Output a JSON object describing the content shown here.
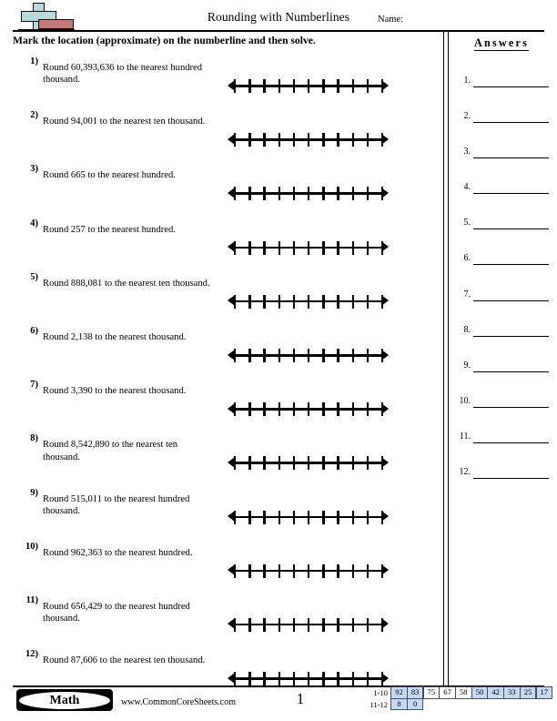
{
  "header": {
    "title": "Rounding with Numberlines",
    "name_label": "Name:",
    "logo_icon": "math-plus-bar-logo"
  },
  "instructions": "Mark the location (approximate) on the numberline and then solve.",
  "numberline": {
    "tick_count": 11,
    "left_arrow_icon": "arrow-left-icon",
    "right_arrow_icon": "arrow-right-icon"
  },
  "problems": [
    {
      "number": "1)",
      "text": "Round 60,393,636 to the nearest hundred thousand."
    },
    {
      "number": "2)",
      "text": "Round 94,001 to the nearest ten thousand."
    },
    {
      "number": "3)",
      "text": "Round 665 to the nearest hundred."
    },
    {
      "number": "4)",
      "text": "Round 257 to the nearest hundred."
    },
    {
      "number": "5)",
      "text": "Round 888,081 to the nearest ten thousand."
    },
    {
      "number": "6)",
      "text": "Round 2,138 to the nearest thousand."
    },
    {
      "number": "7)",
      "text": "Round 3,390 to the nearest thousand."
    },
    {
      "number": "8)",
      "text": "Round 8,542,890 to the nearest ten thousand."
    },
    {
      "number": "9)",
      "text": "Round 515,011 to the nearest hundred thousand."
    },
    {
      "number": "10)",
      "text": "Round 962,363 to the nearest hundred."
    },
    {
      "number": "11)",
      "text": "Round 656,429 to the nearest hundred thousand."
    },
    {
      "number": "12)",
      "text": "Round 87,606 to the nearest ten thousand."
    }
  ],
  "answers": {
    "title": "Answers",
    "items": [
      {
        "number": "1."
      },
      {
        "number": "2."
      },
      {
        "number": "3."
      },
      {
        "number": "4."
      },
      {
        "number": "5."
      },
      {
        "number": "6."
      },
      {
        "number": "7."
      },
      {
        "number": "8."
      },
      {
        "number": "9."
      },
      {
        "number": "10."
      },
      {
        "number": "11."
      },
      {
        "number": "12."
      }
    ]
  },
  "footer": {
    "subject_badge": "Math",
    "site_url": "www.CommonCoreSheets.com",
    "page_number": "1"
  },
  "score_grid": {
    "rows": [
      {
        "label": "1-10",
        "cells": [
          {
            "value": "92",
            "shaded": true
          },
          {
            "value": "83",
            "shaded": true
          },
          {
            "value": "75",
            "shaded": false
          },
          {
            "value": "67",
            "shaded": false
          },
          {
            "value": "58",
            "shaded": false
          },
          {
            "value": "50",
            "shaded": true
          },
          {
            "value": "42",
            "shaded": true
          },
          {
            "value": "33",
            "shaded": true
          },
          {
            "value": "25",
            "shaded": true
          },
          {
            "value": "17",
            "shaded": true
          }
        ]
      },
      {
        "label": "11-12",
        "cells": [
          {
            "value": "8",
            "shaded": true
          },
          {
            "value": "0",
            "shaded": true
          }
        ]
      }
    ],
    "shade_color": "#c5d9f1",
    "border_color": "#4a4a6a"
  }
}
